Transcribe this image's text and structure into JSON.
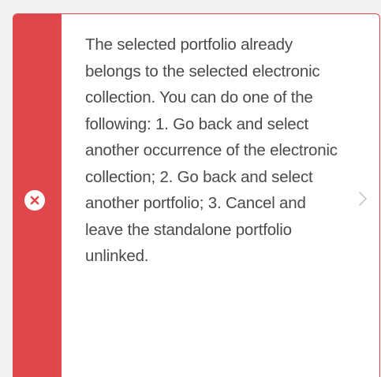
{
  "alert": {
    "type": "error",
    "icon": "error-circle-x-icon",
    "message": "The selected portfolio already belongs to the selected electronic collection. You can do one of the following: 1. Go back and select another occurrence of the electronic collection; 2. Go back and select another portfolio; 3. Cancel and leave the standalone portfolio unlinked.",
    "expand_icon": "chevron-right-icon"
  },
  "colors": {
    "error_accent": "#e0474c",
    "text": "#4a4a4a",
    "background": "#f2f2f2",
    "chevron": "#c8c8c8"
  }
}
